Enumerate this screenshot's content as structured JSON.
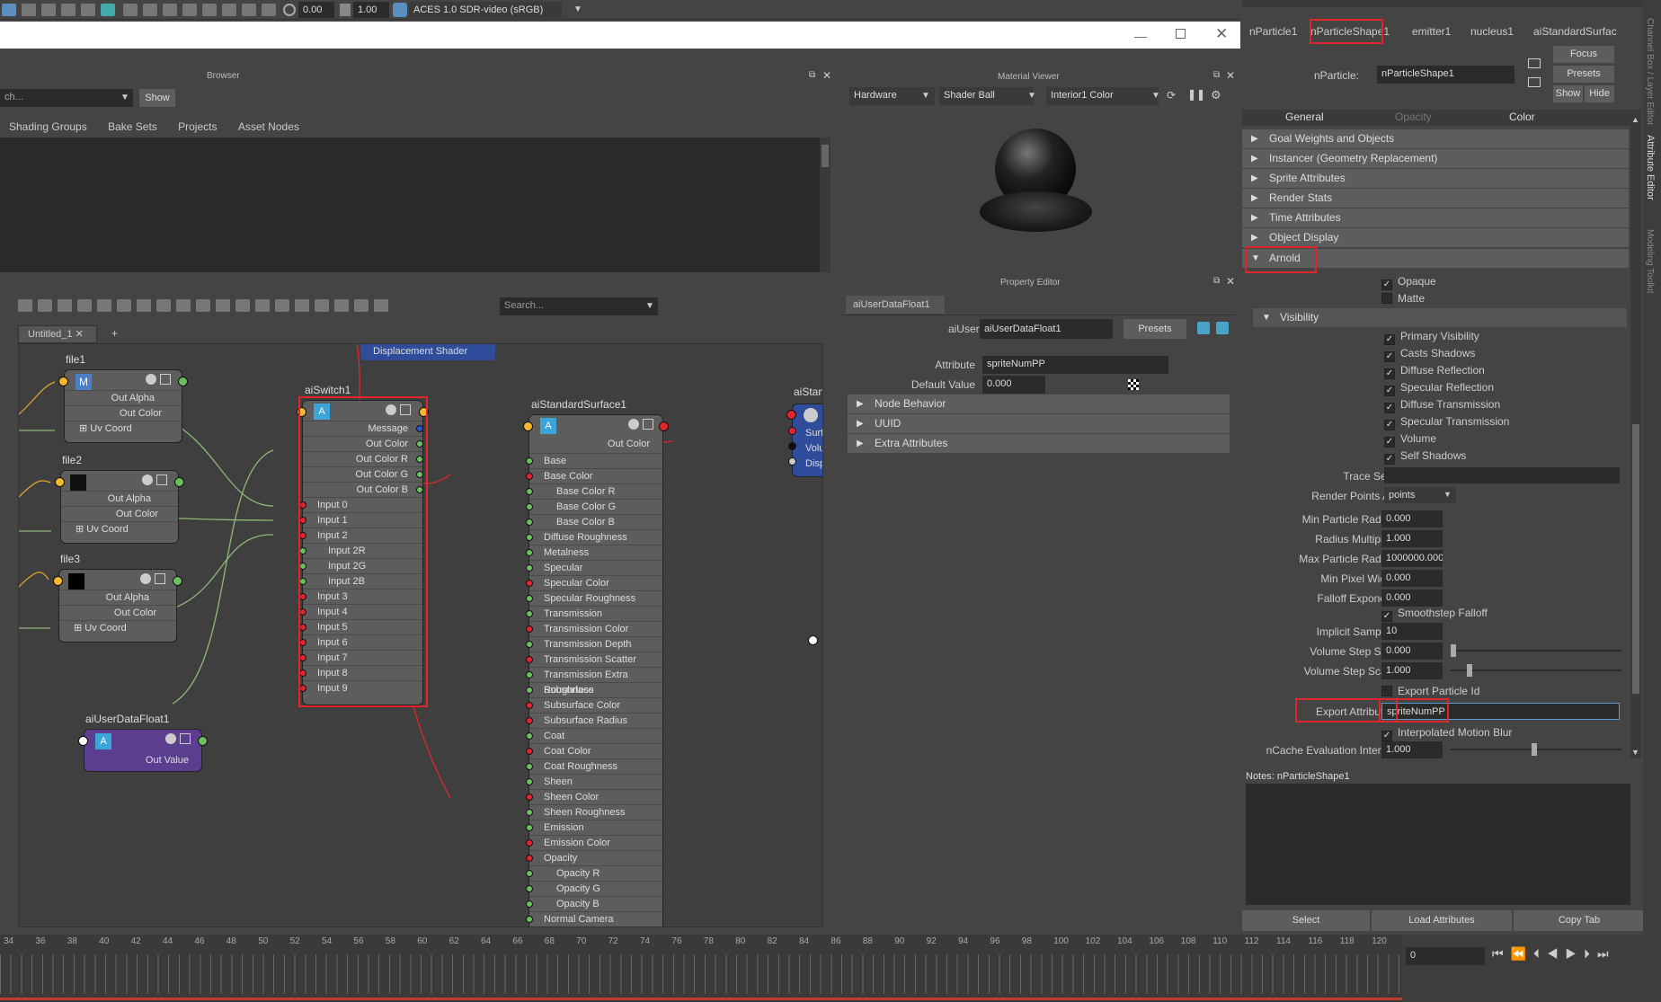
{
  "topbar": {
    "exposure": "0.00",
    "gamma": "1.00",
    "colorspace": "ACES 1.0 SDR-video (sRGB)"
  },
  "browser": {
    "title": "Browser",
    "search_placeholder": "ch...",
    "show_label": "Show",
    "tabs": [
      "Shading Groups",
      "Bake Sets",
      "Projects",
      "Asset Nodes"
    ]
  },
  "node_editor": {
    "search_placeholder": "Search...",
    "tab": "Untitled_1",
    "add_tab": "+",
    "file1": {
      "title": "file1",
      "ports": [
        "Out Alpha",
        "Out Color",
        "Uv Coord"
      ]
    },
    "file2": {
      "title": "file2",
      "ports": [
        "Out Alpha",
        "Out Color",
        "Uv Coord"
      ]
    },
    "file3": {
      "title": "file3",
      "ports": [
        "Out Alpha",
        "Out Color",
        "Uv Coord"
      ]
    },
    "udf": {
      "title": "aiUserDataFloat1",
      "port": "Out Value"
    },
    "switch": {
      "title": "aiSwitch1",
      "ports": [
        "Message",
        "Out Color",
        "Out Color R",
        "Out Color G",
        "Out Color B",
        "Input 0",
        "Input 1",
        "Input 2",
        "Input 2R",
        "Input 2G",
        "Input 2B",
        "Input 3",
        "Input 4",
        "Input 5",
        "Input 6",
        "Input 7",
        "Input 8",
        "Input 9"
      ]
    },
    "std": {
      "title": "aiStandardSurface1",
      "out": "Out Color",
      "ports": [
        "Base",
        "Base Color",
        "Base Color R",
        "Base Color G",
        "Base Color B",
        "Diffuse Roughness",
        "Metalness",
        "Specular",
        "Specular Color",
        "Specular Roughness",
        "Transmission",
        "Transmission Color",
        "Transmission Depth",
        "Transmission Scatter",
        "Transmission Extra Roughness",
        "Subsurface",
        "Subsurface Color",
        "Subsurface Radius",
        "Coat",
        "Coat Color",
        "Coat Roughness",
        "Sheen",
        "Sheen Color",
        "Sheen Roughness",
        "Emission",
        "Emission Color",
        "Opacity",
        "Opacity R",
        "Opacity G",
        "Opacity B",
        "Normal Camera"
      ]
    },
    "disp": "Displacement Shader",
    "sg": {
      "title": "aiStan",
      "ports": [
        "Surf",
        "Volu",
        "Disp"
      ]
    }
  },
  "material_viewer": {
    "title": "Material Viewer",
    "renderer": "Hardware",
    "shape": "Shader Ball",
    "env": "Interior1 Color"
  },
  "property_editor": {
    "title": "Property Editor",
    "tab": "aiUserDataFloat1",
    "label": "aiUserDataFloat:",
    "node": "aiUserDataFloat1",
    "presets": "Presets",
    "attribute_label": "Attribute",
    "attribute_value": "spriteNumPP",
    "default_label": "Default Value",
    "default_value": "0.000",
    "sections": [
      "Node Behavior",
      "UUID",
      "Extra Attributes"
    ]
  },
  "attr_editor": {
    "tabs": [
      "nParticle1",
      "nParticleShape1",
      "emitter1",
      "nucleus1",
      "aiStandardSurfac"
    ],
    "node_label": "nParticle:",
    "node_value": "nParticleShape1",
    "focus": "Focus",
    "presets": "Presets",
    "show": "Show",
    "hide": "Hide",
    "subtabs": [
      "General",
      "Opacity",
      "Color"
    ],
    "sections": [
      "Goal Weights and Objects",
      "Instancer (Geometry Replacement)",
      "Sprite Attributes",
      "Render Stats",
      "Time Attributes",
      "Object Display"
    ],
    "arnold": "Arnold",
    "opaque": "Opaque",
    "matte": "Matte",
    "visibility": "Visibility",
    "vis_items": [
      "Primary Visibility",
      "Casts Shadows",
      "Diffuse Reflection",
      "Specular Reflection",
      "Diffuse Transmission",
      "Specular Transmission",
      "Volume",
      "Self Shadows"
    ],
    "trace_sets": "Trace Sets",
    "render_points_as_label": "Render Points As",
    "render_points_as": "points",
    "fields": [
      {
        "label": "Min Particle Radius",
        "value": "0.000"
      },
      {
        "label": "Radius Multiplier",
        "value": "1.000"
      },
      {
        "label": "Max Particle Radius",
        "value": "1000000.000"
      },
      {
        "label": "Min Pixel Width",
        "value": "0.000"
      },
      {
        "label": "Falloff Exponent",
        "value": "0.000"
      }
    ],
    "smoothstep": "Smoothstep Falloff",
    "implicit_label": "Implicit Samples",
    "implicit": "10",
    "vss_label": "Volume Step Size",
    "vss": "0.000",
    "vssc_label": "Volume Step Scale",
    "vssc": "1.000",
    "export_pid": "Export Particle Id",
    "export_attr_label": "Export Attributes",
    "export_attr": "spriteNumPP",
    "interp": "Interpolated Motion Blur",
    "ncache_label": "nCache Evaluation Interval",
    "ncache": "1.000",
    "notes": "Notes:  nParticleShape1",
    "select": "Select",
    "load": "Load Attributes",
    "copy": "Copy Tab",
    "side_tabs": [
      "Channel Box / Layer Editor",
      "Attribute Editor",
      "Modeling Toolkit"
    ]
  },
  "timeline": {
    "ticks": [
      "34",
      "36",
      "38",
      "40",
      "42",
      "44",
      "46",
      "48",
      "50",
      "52",
      "54",
      "56",
      "58",
      "60",
      "62",
      "64",
      "66",
      "68",
      "70",
      "72",
      "74",
      "76",
      "78",
      "80",
      "82",
      "84",
      "86",
      "88",
      "90",
      "92",
      "94",
      "96",
      "98",
      "100",
      "102",
      "104",
      "106",
      "108",
      "110",
      "112",
      "114",
      "116",
      "118",
      "120"
    ],
    "frame": "0"
  }
}
